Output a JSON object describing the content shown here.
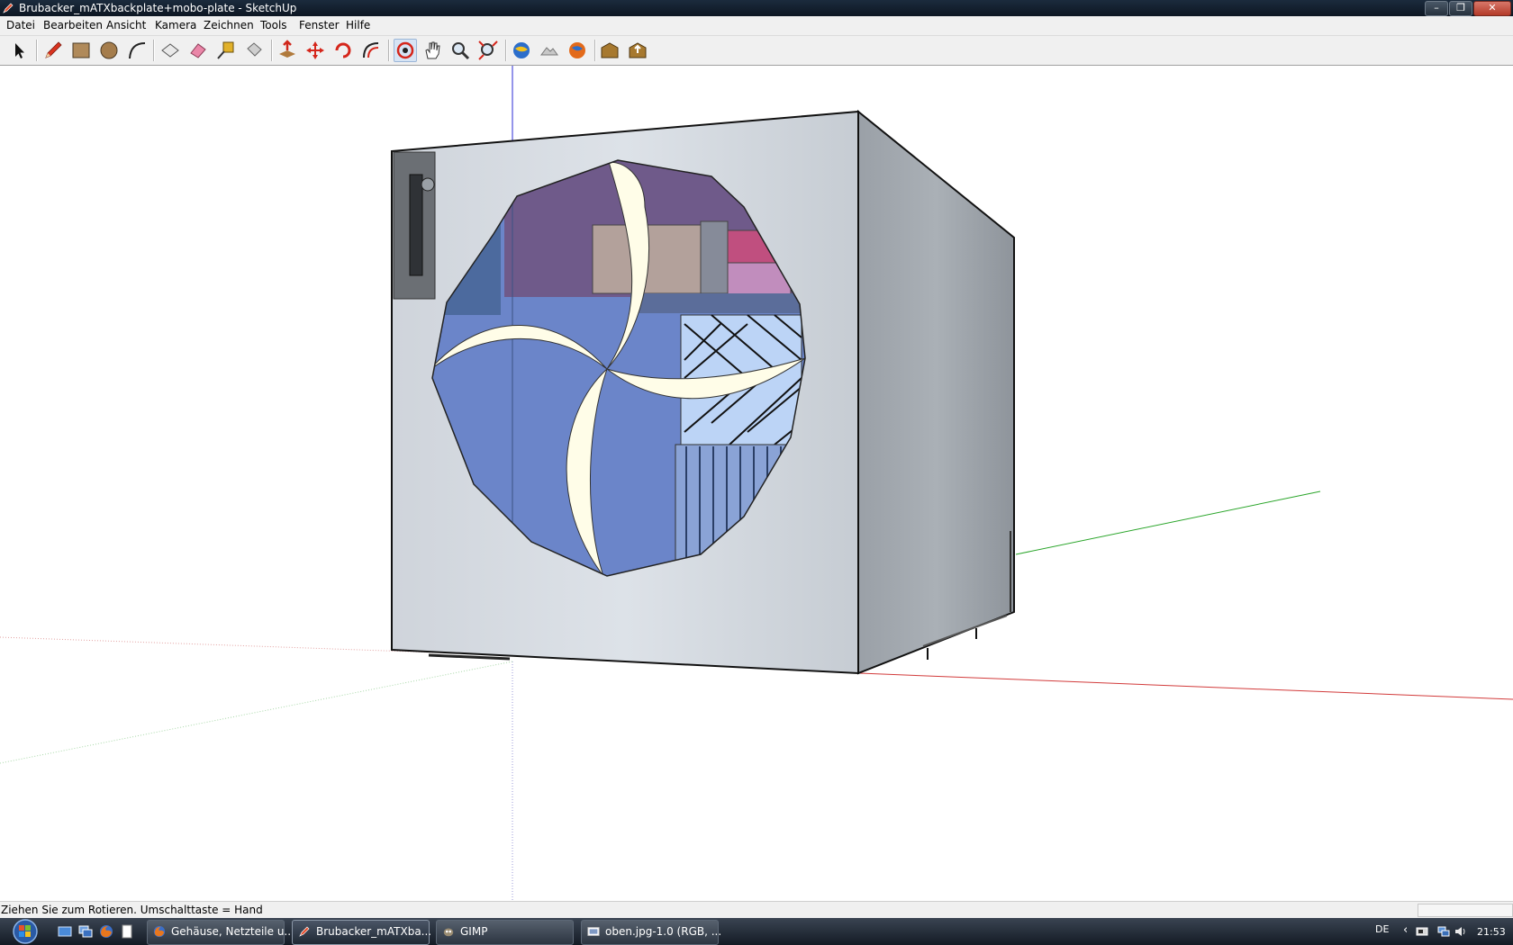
{
  "window": {
    "title": "Brubacker_mATXbackplate+mobo-plate - SketchUp",
    "app_icon": "sketchup-pencil-icon",
    "controls": [
      "minimize-icon",
      "maximize-icon",
      "close-icon"
    ]
  },
  "menu": {
    "items": [
      "Datei",
      "Bearbeiten",
      "Ansicht",
      "Kamera",
      "Zeichnen",
      "Tools",
      "Fenster",
      "Hilfe"
    ]
  },
  "toolbar": {
    "tools": [
      {
        "name": "select-tool",
        "icon": "arrow-cursor-icon"
      },
      {
        "name": "line-tool",
        "icon": "pencil-icon"
      },
      {
        "name": "rectangle-tool",
        "icon": "rectangle-icon"
      },
      {
        "name": "circle-tool",
        "icon": "circle-icon"
      },
      {
        "name": "arc-tool",
        "icon": "arc-icon"
      },
      {
        "name": "make-component-tool",
        "icon": "component-icon"
      },
      {
        "name": "eraser-tool",
        "icon": "eraser-icon"
      },
      {
        "name": "tape-measure-tool",
        "icon": "tape-measure-icon"
      },
      {
        "name": "paint-bucket-tool",
        "icon": "paint-bucket-icon"
      },
      {
        "name": "push-pull-tool",
        "icon": "push-pull-icon"
      },
      {
        "name": "move-tool",
        "icon": "move-icon"
      },
      {
        "name": "rotate-tool",
        "icon": "rotate-icon"
      },
      {
        "name": "offset-tool",
        "icon": "offset-icon"
      },
      {
        "name": "orbit-tool",
        "icon": "orbit-icon",
        "active": true
      },
      {
        "name": "pan-tool",
        "icon": "hand-icon"
      },
      {
        "name": "zoom-tool",
        "icon": "magnifier-icon"
      },
      {
        "name": "zoom-extents-tool",
        "icon": "zoom-extents-icon"
      },
      {
        "name": "google-earth-view",
        "icon": "earth-icon"
      },
      {
        "name": "get-current-view",
        "icon": "terrain-icon"
      },
      {
        "name": "toggle-terrain",
        "icon": "earth-orange-icon"
      },
      {
        "name": "get-models",
        "icon": "warehouse-icon"
      },
      {
        "name": "share-model",
        "icon": "warehouse-share-icon"
      }
    ]
  },
  "status": {
    "text": "Ziehen Sie zum Rotieren.  Umschalttaste = Hand",
    "measurements_value": ""
  },
  "taskbar": {
    "quicklaunch": [
      "show-desktop-icon",
      "switch-windows-icon",
      "firefox-icon",
      "notepad-icon"
    ],
    "tasks": [
      {
        "label": "Gehäuse, Netzteile u...",
        "icon": "firefox-icon"
      },
      {
        "label": "Brubacker_mATXba...",
        "icon": "sketchup-pencil-icon",
        "active": true
      },
      {
        "label": "GIMP",
        "icon": "gimp-icon"
      },
      {
        "label": "oben.jpg-1.0 (RGB, ...",
        "icon": "gimp-image-icon"
      }
    ],
    "tray": {
      "language": "DE",
      "icons": [
        "show-hidden-icons-icon",
        "network-icon",
        "volume-icon",
        "safely-remove-icon"
      ],
      "clock": "21:53"
    }
  },
  "colors": {
    "titlebar": "#111c28",
    "menubar": "#f0f0f0",
    "red_axis": "#d23b3b",
    "green_axis": "#2aa52a",
    "blue_axis": "#2b2bd6",
    "fan_blue": "#6b85c9",
    "fan_blade": "#fffde8"
  }
}
